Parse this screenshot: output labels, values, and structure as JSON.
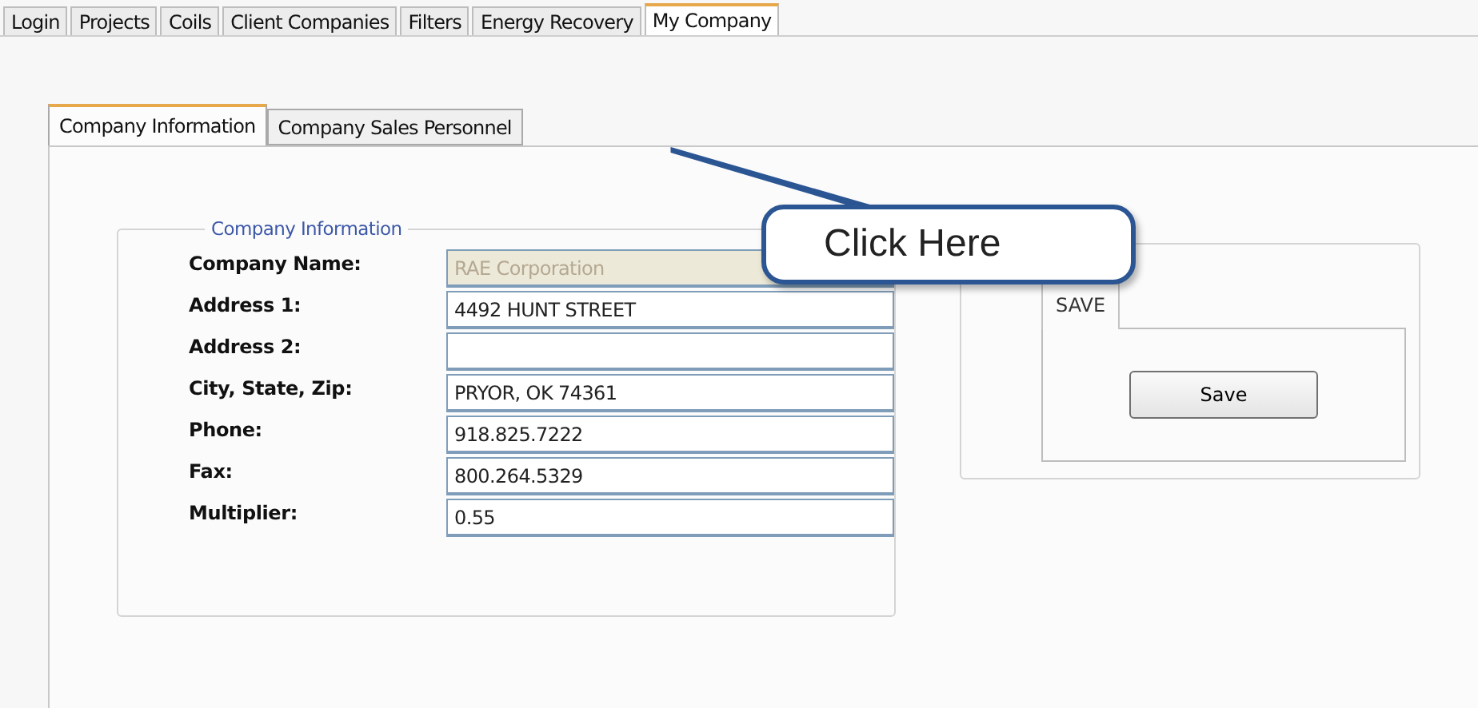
{
  "main_tabs": [
    {
      "label": "Login",
      "selected": false
    },
    {
      "label": "Projects",
      "selected": false
    },
    {
      "label": "Coils",
      "selected": false
    },
    {
      "label": "Client Companies",
      "selected": false
    },
    {
      "label": "Filters",
      "selected": false
    },
    {
      "label": "Energy Recovery",
      "selected": false
    },
    {
      "label": "My Company",
      "selected": true
    }
  ],
  "sub_tabs": [
    {
      "label": "Company Information",
      "selected": true
    },
    {
      "label": "Company Sales Personnel",
      "selected": false
    }
  ],
  "callout": {
    "text": "Click Here"
  },
  "company_information": {
    "title": "Company Information",
    "fields": [
      {
        "label": "Company Name:",
        "value": "RAE Corporation",
        "disabled": true
      },
      {
        "label": "Address 1:",
        "value": "4492 HUNT STREET",
        "disabled": false
      },
      {
        "label": "Address 2:",
        "disabled": false
      },
      {
        "label": "City, State, Zip:",
        "value": "PRYOR, OK 74361",
        "disabled": false
      },
      {
        "label": "Phone:",
        "value": "918.825.7222",
        "disabled": false
      },
      {
        "label": "Fax:",
        "value": "800.264.5329",
        "disabled": false
      },
      {
        "label": "Multiplier:",
        "value": "0.55",
        "disabled": false
      }
    ]
  },
  "save_panel": {
    "tab": "SAVE",
    "button": "Save"
  }
}
